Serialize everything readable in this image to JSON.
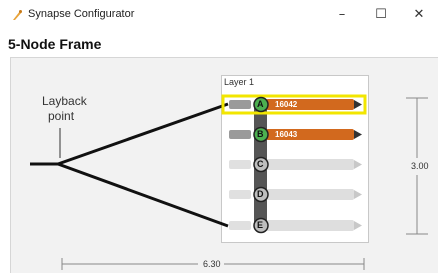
{
  "window": {
    "title": "Synapse Configurator",
    "minimize_glyph": "–",
    "maximize_glyph": "☐",
    "close_glyph": "✕"
  },
  "heading": "5-Node Frame",
  "diagram": {
    "layback_label_line1": "Layback",
    "layback_label_line2": "point",
    "layer_title": "Layer 1",
    "dimension_horizontal": "6.30",
    "dimension_vertical": "3.00",
    "nodes": [
      {
        "letter": "A",
        "serial": "16042",
        "active": true,
        "selected": true
      },
      {
        "letter": "B",
        "serial": "16043",
        "active": true,
        "selected": false
      },
      {
        "letter": "C",
        "serial": "",
        "active": false,
        "selected": false
      },
      {
        "letter": "D",
        "serial": "",
        "active": false,
        "selected": false
      },
      {
        "letter": "E",
        "serial": "",
        "active": false,
        "selected": false
      }
    ]
  },
  "colors": {
    "active_lead": "#d2691e",
    "active_badge": "#4caf50",
    "selection": "#f2e600",
    "inactive_lead": "#d9d9d9"
  }
}
